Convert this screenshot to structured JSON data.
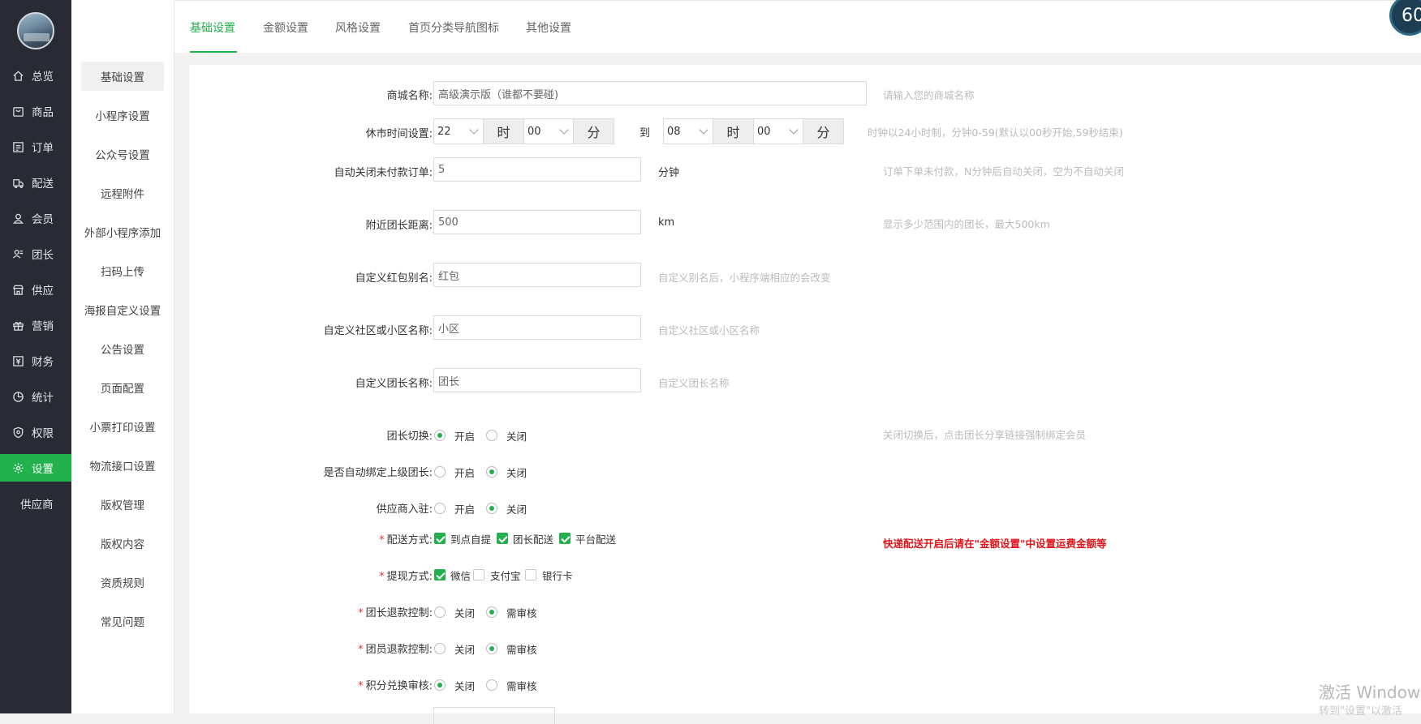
{
  "nav": {
    "items": [
      {
        "label": "总览",
        "icon": "home-icon"
      },
      {
        "label": "商品",
        "icon": "goods-icon"
      },
      {
        "label": "订单",
        "icon": "order-icon"
      },
      {
        "label": "配送",
        "icon": "delivery-icon"
      },
      {
        "label": "会员",
        "icon": "member-icon"
      },
      {
        "label": "团长",
        "icon": "leader-icon"
      },
      {
        "label": "供应",
        "icon": "supply-icon"
      },
      {
        "label": "营销",
        "icon": "gift-icon"
      },
      {
        "label": "财务",
        "icon": "finance-icon"
      },
      {
        "label": "统计",
        "icon": "pie-chart-icon"
      },
      {
        "label": "权限",
        "icon": "shield-icon"
      },
      {
        "label": "设置",
        "icon": "gear-icon"
      },
      {
        "label": "供应商",
        "icon": ""
      }
    ],
    "active": "设置"
  },
  "subnav": {
    "items": [
      "基础设置",
      "小程序设置",
      "公众号设置",
      "远程附件",
      "外部小程序添加",
      "扫码上传",
      "海报自定义设置",
      "公告设置",
      "页面配置",
      "小票打印设置",
      "物流接口设置",
      "版权管理",
      "版权内容",
      "资质规则",
      "常见问题"
    ],
    "active": "基础设置"
  },
  "tabs": {
    "items": [
      "基础设置",
      "金额设置",
      "风格设置",
      "首页分类导航图标",
      "其他设置"
    ],
    "active": "基础设置"
  },
  "badge": "60",
  "form": {
    "shop_name": {
      "label": "商城名称:",
      "value": "高级演示版（谁都不要碰)",
      "hint": "请输入您的商城名称"
    },
    "closing_time": {
      "label": "休市时间设置:",
      "start_hour": "22",
      "hour_unit": "时",
      "start_min": "00",
      "min_unit": "分",
      "to": "到",
      "end_hour": "08",
      "end_min": "00",
      "hint": "时钟以24小时制，分钟0-59(默认以00秒开始,59秒结束)"
    },
    "auto_close": {
      "label": "自动关闭未付款订单:",
      "value": "5",
      "unit": "分钟",
      "hint": "订单下单未付款，N分钟后自动关闭，空为不自动关闭"
    },
    "distance": {
      "label": "附近团长距离:",
      "value": "500",
      "unit": "km",
      "hint": "显示多少范围内的团长，最大500km"
    },
    "redpack_alias": {
      "label": "自定义红包别名:",
      "value": "红包",
      "hint": "自定义别名后，小程序端相应的会改变"
    },
    "community_alias": {
      "label": "自定义社区或小区名称:",
      "value": "小区",
      "hint": "自定义社区或小区名称"
    },
    "leader_alias": {
      "label": "自定义团长名称:",
      "value": "团长",
      "hint": "自定义团长名称"
    },
    "leader_switch": {
      "label": "团长切换:",
      "opt1": "开启",
      "opt2": "关闭",
      "selected": 1,
      "hint": "关闭切换后，点击团长分享链接强制绑定会员"
    },
    "auto_bind": {
      "label": "是否自动绑定上级团长:",
      "opt1": "开启",
      "opt2": "关闭",
      "selected": 2
    },
    "supplier_join": {
      "label": "供应商入驻:",
      "opt1": "开启",
      "opt2": "关闭",
      "selected": 2
    },
    "delivery": {
      "label": "配送方式:",
      "opt1": "到点自提",
      "opt2": "团长配送",
      "opt3": "平台配送",
      "hint": "快递配送开启后请在\"金额设置\"中设置运费金额等"
    },
    "withdraw": {
      "label": "提现方式:",
      "opt1": "微信",
      "opt2": "支付宝",
      "opt3": "银行卡"
    },
    "leader_refund": {
      "label": "团长退款控制:",
      "opt1": "关闭",
      "opt2": "需审核",
      "selected": 2
    },
    "member_refund": {
      "label": "团员退款控制:",
      "opt1": "关闭",
      "opt2": "需审核",
      "selected": 2
    },
    "points_review": {
      "label": "积分兑换审核:",
      "opt1": "关闭",
      "opt2": "需审核",
      "selected": 1
    }
  },
  "watermark": {
    "line1": "激活 Window",
    "line2": "转到\"设置\"以激活"
  }
}
